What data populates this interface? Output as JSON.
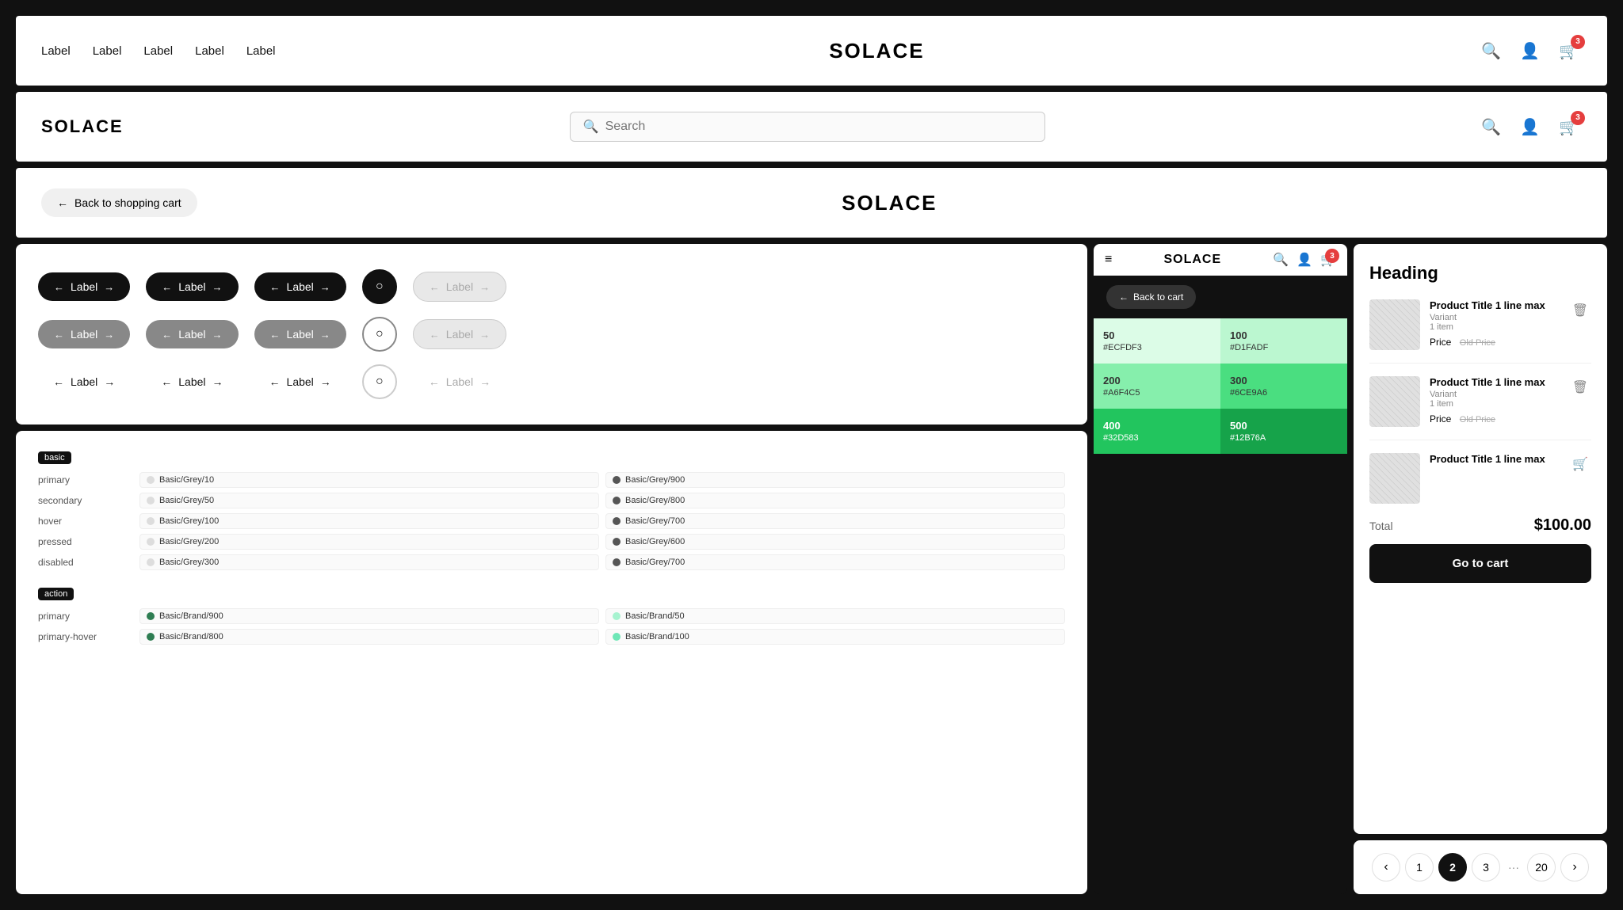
{
  "navbar1": {
    "links": [
      "Label",
      "Label",
      "Label",
      "Label",
      "Label"
    ],
    "brand": "SOLACE",
    "cart_count": "3"
  },
  "navbar2": {
    "brand": "SOLACE",
    "search_placeholder": "Search",
    "cart_count": "3"
  },
  "navbar3": {
    "back_label": "Back to shopping cart",
    "brand": "SOLACE"
  },
  "buttons": {
    "rows": [
      {
        "type": "pill-dark",
        "label": "Label"
      },
      {
        "type": "pill-dark",
        "label": "Label"
      },
      {
        "type": "pill-dark",
        "label": "Label"
      },
      {
        "type": "circle-dark"
      },
      {
        "type": "pill-light-outline",
        "label": "Label"
      },
      {
        "type": "pill-mid",
        "label": "Label"
      },
      {
        "type": "pill-mid",
        "label": "Label"
      },
      {
        "type": "pill-mid",
        "label": "Label"
      },
      {
        "type": "circle-plain"
      },
      {
        "type": "pill-light-outline",
        "label": "Label"
      },
      {
        "type": "pill-plain",
        "label": "Label"
      },
      {
        "type": "pill-plain",
        "label": "Label"
      },
      {
        "type": "pill-plain",
        "label": "Label"
      },
      {
        "type": "circle-outline"
      },
      {
        "type": "pill-plain-light",
        "label": "Label"
      }
    ]
  },
  "tokens": {
    "basic_label": "basic",
    "action_label": "action",
    "basic_rows": [
      {
        "name": "primary",
        "lm": "Basic/Grey/10",
        "dm": "Basic/Grey/900"
      },
      {
        "name": "secondary",
        "lm": "Basic/Grey/50",
        "dm": "Basic/Grey/800"
      },
      {
        "name": "hover",
        "lm": "Basic/Grey/100",
        "dm": "Basic/Grey/700"
      },
      {
        "name": "pressed",
        "lm": "Basic/Grey/200",
        "dm": "Basic/Grey/600"
      },
      {
        "name": "disabled",
        "lm": "Basic/Grey/300",
        "dm": "Basic/Grey/700"
      }
    ],
    "action_rows": [
      {
        "name": "primary",
        "lm": "Basic/Brand/900",
        "dm": "Basic/Brand/50"
      },
      {
        "name": "primary-hover",
        "lm": "Basic/Brand/800",
        "dm": "Basic/Brand/100"
      }
    ]
  },
  "mini_browser": {
    "brand": "SOLACE",
    "back_label": "Back to cart",
    "swatches": [
      {
        "num": "50",
        "hex": "#ECFDF3",
        "pair_num": "100",
        "pair_hex": "#D1FADF",
        "bg_l": "#dcfce7",
        "bg_r": "#bbf7d0",
        "text": "light"
      },
      {
        "num": "200",
        "hex": "#A6F4C5",
        "pair_num": "300",
        "pair_hex": "#6CE9A6",
        "bg_l": "#86efac",
        "bg_r": "#4ade80",
        "text": "light"
      },
      {
        "num": "400",
        "hex": "#32D583",
        "pair_num": "500",
        "pair_hex": "#12B76A",
        "bg_l": "#22c55e",
        "bg_r": "#16a34a",
        "text": "dark"
      }
    ]
  },
  "cart": {
    "heading": "Heading",
    "items": [
      {
        "title": "Product Title 1 line max",
        "variant": "Variant",
        "count": "1 item",
        "price": "Price",
        "old_price": "Old Price"
      },
      {
        "title": "Product Title 1 line max",
        "variant": "Variant",
        "count": "1 item",
        "price": "Price",
        "old_price": "Old Price"
      },
      {
        "title": "Product Title 1 line max",
        "variant": "",
        "count": "",
        "price": "",
        "old_price": ""
      }
    ],
    "total_label": "Total",
    "total_value": "$100.00",
    "go_to_cart": "Go to cart"
  },
  "pagination": {
    "prev": "←",
    "next": "→",
    "pages": [
      "1",
      "2",
      "3"
    ],
    "dots": "···",
    "last": "20",
    "active": "2"
  }
}
